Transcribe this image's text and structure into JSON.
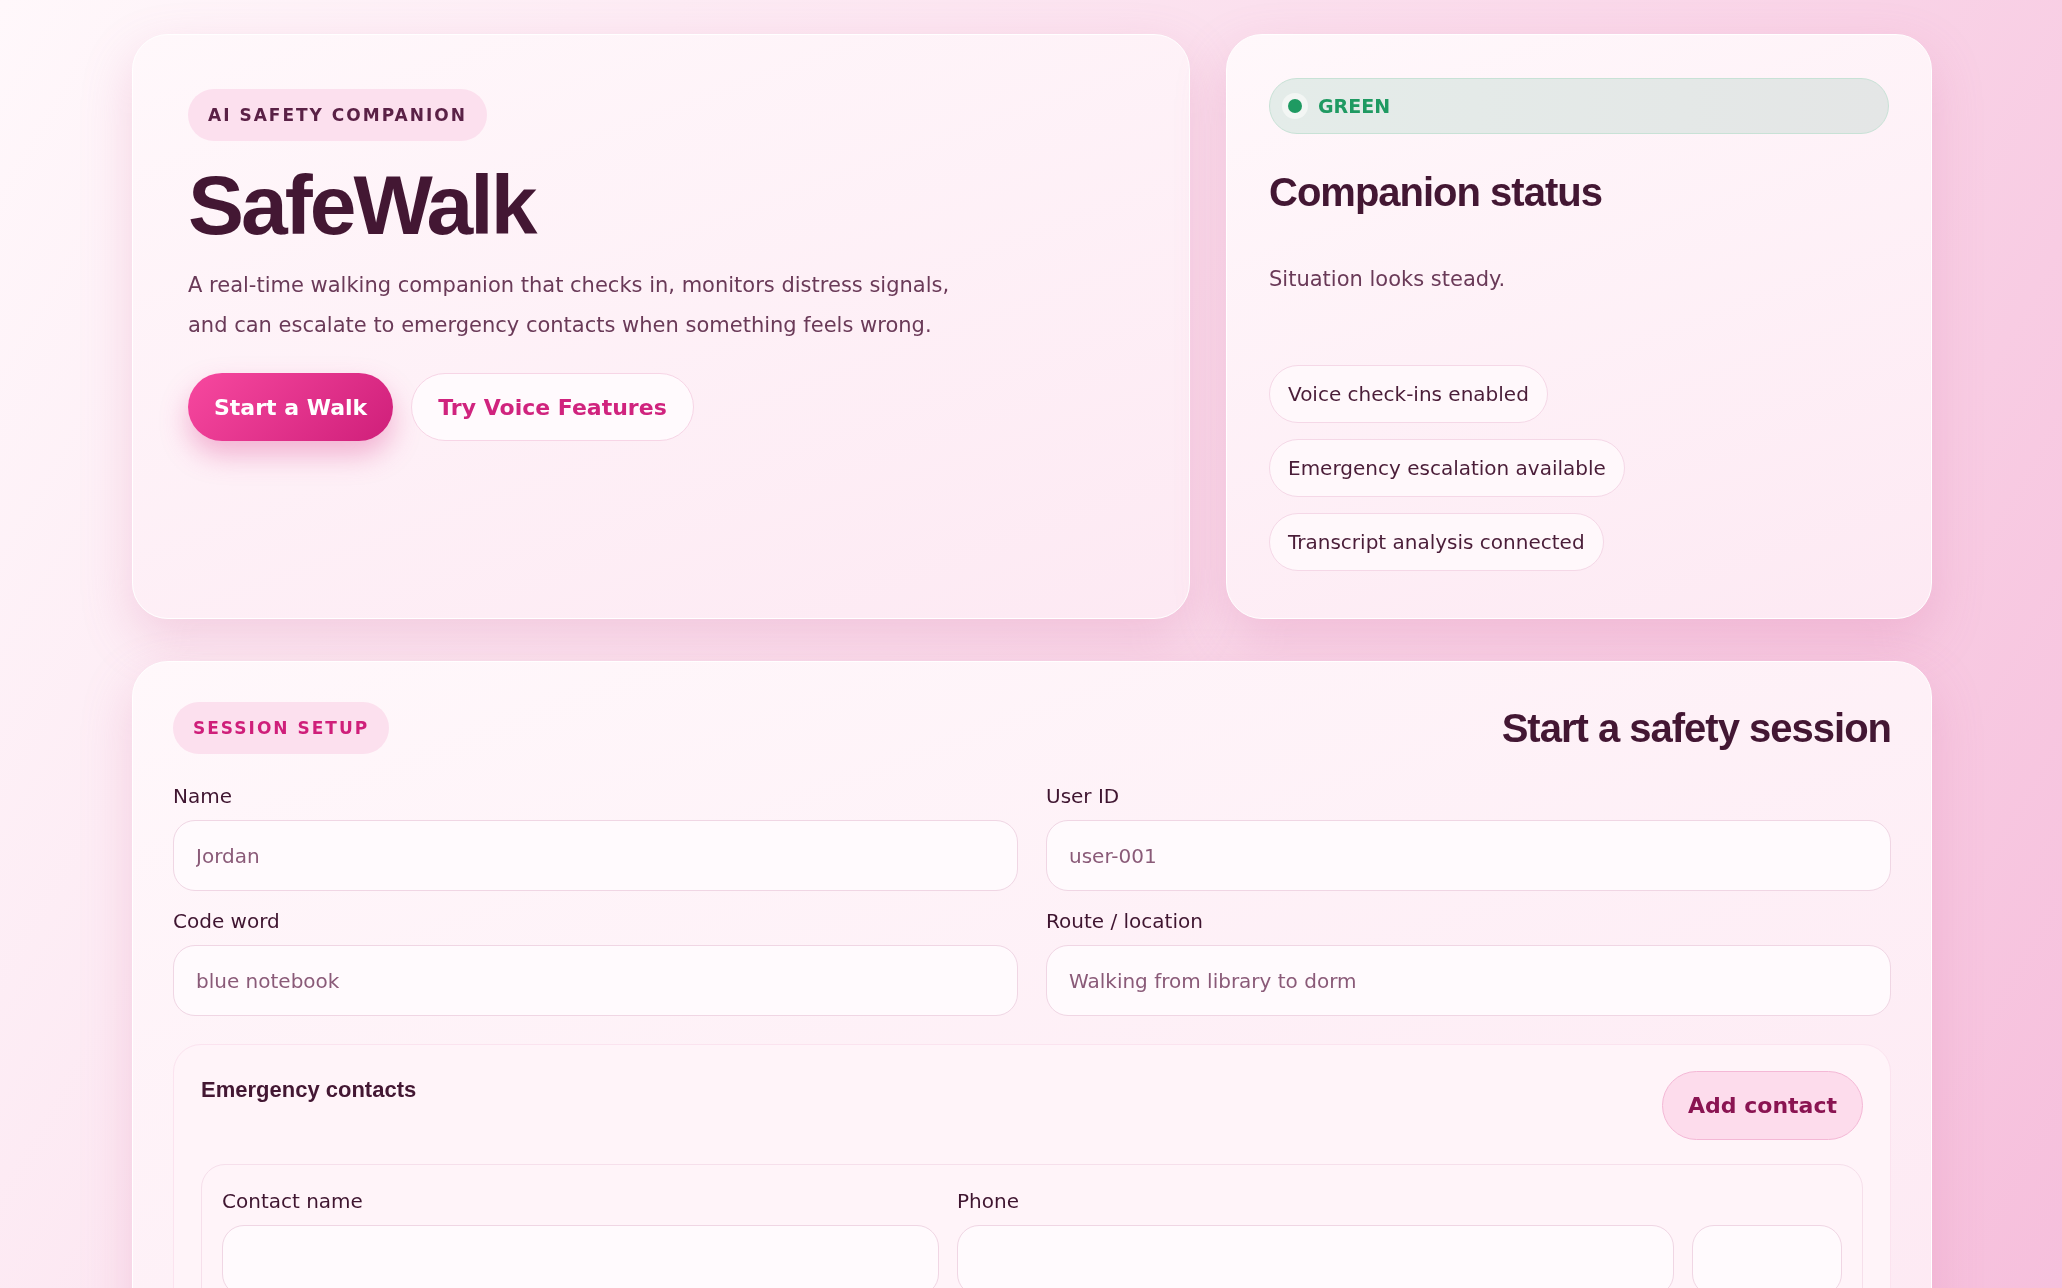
{
  "hero": {
    "badge": "AI SAFETY COMPANION",
    "title": "SafeWalk",
    "description": "A real-time walking companion that checks in, monitors distress signals, and can escalate to emergency contacts when something feels wrong.",
    "buttons": [
      {
        "label": "Start a Walk",
        "kind": "primary"
      },
      {
        "label": "Try Voice Features",
        "kind": "secondary"
      }
    ]
  },
  "status": {
    "indicator": "GREEN",
    "title": "Companion status",
    "message": "Situation looks steady.",
    "chips": [
      "Voice check-ins enabled",
      "Emergency escalation available",
      "Transcript analysis connected"
    ]
  },
  "session": {
    "badge": "SESSION SETUP",
    "title": "Start a safety session",
    "fields": [
      {
        "label": "Name",
        "placeholder": "Jordan"
      },
      {
        "label": "User ID",
        "placeholder": "user-001"
      },
      {
        "label": "Code word",
        "placeholder": "blue notebook"
      },
      {
        "label": "Route / location",
        "placeholder": "Walking from library to dorm"
      }
    ],
    "contacts": {
      "title": "Emergency contacts",
      "add_button": "Add contact",
      "columns": [
        "Contact name",
        "Phone"
      ]
    }
  }
}
